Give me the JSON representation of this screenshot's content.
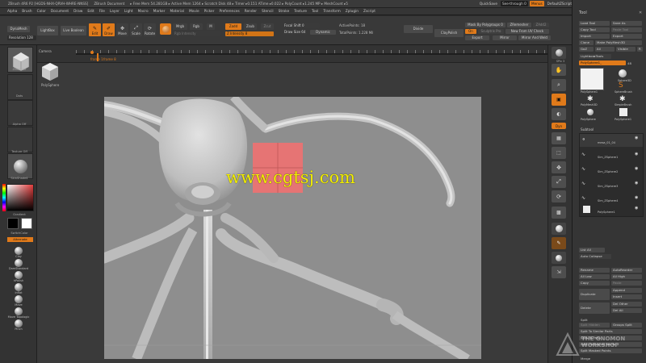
{
  "titlebar": {
    "app": "ZBrush 4R6 P2 [HGDS-NHX-QRVH-WHRE-NNSS]",
    "doc": "ZBrush Document",
    "stats": "▸ Free Mem 54.281GB ▸ Active Mem 1264 ▸ Scratch Disk 48 ▸ Timer ▸0.151 ATime ▸0.022 ▸ PolyCount ▸1.245 MP ▸ MeshCount ▸5",
    "quicksave": "QuickSave",
    "seethrough": "See-through   0",
    "menus": "Menus",
    "default_script": "DefaultZScript"
  },
  "menubar": [
    "Alpha",
    "Brush",
    "Color",
    "Document",
    "Draw",
    "Edit",
    "File",
    "Layer",
    "Light",
    "Macro",
    "Marker",
    "Material",
    "Movie",
    "Picker",
    "Preferences",
    "Render",
    "Stencil",
    "Stroke",
    "Texture",
    "Tool",
    "Transform",
    "Zplugin",
    "Zscript"
  ],
  "shelf": {
    "dynamesh": "DynaMesh",
    "resolution": "Resolution 128",
    "lightbox": "LightBox",
    "live_boolean": "Live Boolean",
    "edit": "Edit",
    "draw": "Draw",
    "move": "Move",
    "scale": "Scale",
    "rotate": "Rotate",
    "mrgb": "Mrgb",
    "rgb": "Rgb",
    "m": "M",
    "rgb_intensity": "Rgb Intensity",
    "zadd": "Zadd",
    "zsub": "Zsub",
    "zcut": "Zcut",
    "z_intensity": "Z Intensity 8",
    "focal_shift": "Focal Shift 0",
    "draw_size": "Draw Size 64",
    "dynamic": "Dynamic",
    "active_points": "ActivePoints: 18",
    "total_points": "TotalPoints: 1.228 Mil",
    "divide": "Divide",
    "claypolish": "ClayPolish",
    "mask_by_polygroups": "Mask By Polygroups 0",
    "zremesher": "ZRemesher",
    "create": "Create",
    "sculptris": "Sculptris Pro",
    "new_from_uv": "New From UV Check",
    "export": "Export",
    "mirror": "Mirror",
    "mirror_weld": "Mirror And Weld",
    "zadd2": "ZAdd2",
    "on": "On"
  },
  "timeline": {
    "camera": "Camera",
    "marker_a": "frame 1",
    "marker_b": "frame 8"
  },
  "doc": {
    "thumb_label": "PolySphere"
  },
  "leftpanel": {
    "zmodeler": "ZModeler",
    "dots": "Dots",
    "alpha_off": "Alpha Off",
    "texture_off": "Texture Off",
    "skinshade": "SkinShade4",
    "gradient": "Gradient",
    "switch_color": "SwitchColor",
    "alternate": "Alternate",
    "brushes": [
      "Clay",
      "DamStandard",
      "hPolish",
      "Inflat",
      "Move",
      "Move Topologic",
      "Pinch"
    ]
  },
  "righticons": [
    "BPR",
    "SPix 3",
    "Scroll",
    "Zoom",
    "Actual",
    "AAHalf",
    "Dynamic",
    "Persp",
    "Floor",
    "Local",
    "L.Sym",
    "Frame",
    "Move",
    "Scale",
    "Rotate",
    "Line Fill",
    "PolyF",
    "Transp",
    "Ghost",
    "Solo",
    "Xpose"
  ],
  "tool": {
    "title": "Tool",
    "load_tool": "Load Tool",
    "save_as": "Save As",
    "copy_tool": "Copy Tool",
    "paste_tool": "Paste Tool",
    "import": "Import",
    "export": "Export",
    "clone": "Clone",
    "make_polymesh": "Make PolyMesh3D",
    "goz": "GoZ",
    "all": "All",
    "visible": "Visible",
    "r": "R",
    "lightbox_tools": "Lightbox▸Tools",
    "polysphere_current": "PolySphere1_",
    "polysphere_count": "48",
    "tools": [
      "PolySphere1",
      "SphereBrush",
      "PolyMesh3D",
      "SimpleBrush",
      "PolySphere",
      "PolySphere1"
    ],
    "subtool_title": "Subtool",
    "subtools": [
      "mesa_01_04",
      "Sim_ZSphere1",
      "Sim_ZSphere2",
      "Sim_ZSphere3",
      "Sim_ZSphere4",
      "PolySphere1"
    ],
    "list_all": "List All",
    "auto_collapse": "Auto Collapse",
    "rename": "Rename",
    "auto_reorder": "AutoReorder",
    "all_low": "All Low",
    "all_high": "All High",
    "copy": "Copy",
    "paste": "Paste",
    "duplicate": "Duplicate",
    "append": "Append",
    "insert": "Insert",
    "delete": "Delete",
    "del_other": "Del Other",
    "del_all": "Del All",
    "split": "Split",
    "split_hidden": "Split Hidden",
    "groups_split": "Groups Split",
    "split_similar": "Split To Similar Parts",
    "split_parts": "Split To Parts",
    "split_unmasked": "Split Unmasked Points",
    "split_masked": "Split Masked Points",
    "merge": "Merge"
  },
  "watermark": "www.cgtsj.com",
  "brandmark": "THE GNOMON WORKSHOP"
}
